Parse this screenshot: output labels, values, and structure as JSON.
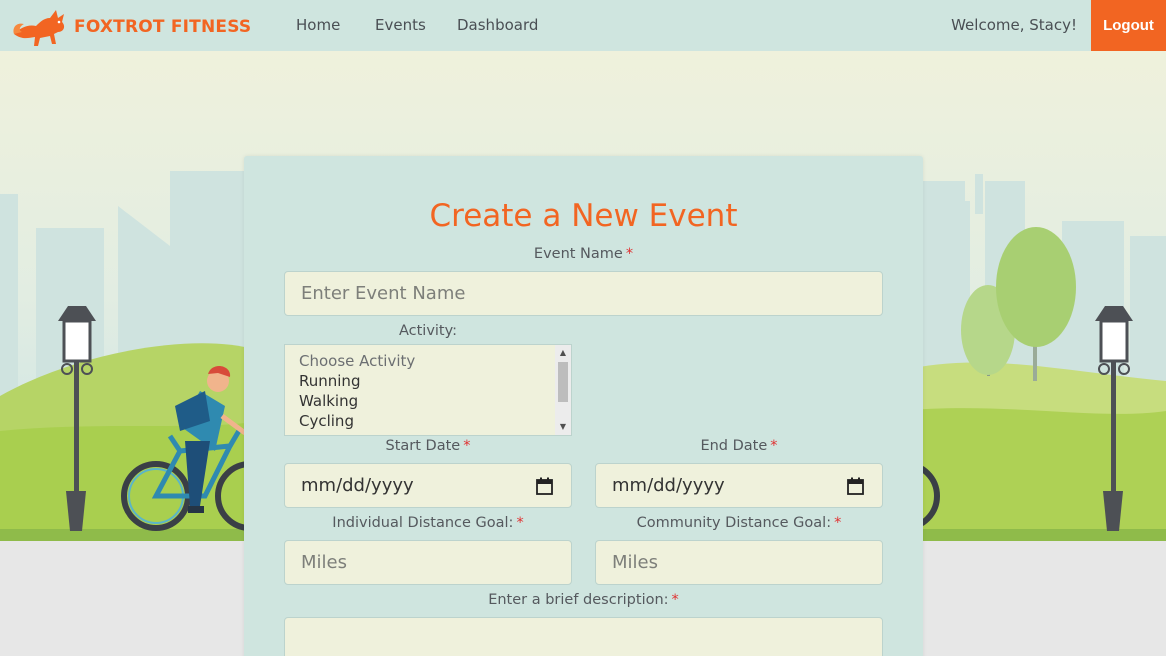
{
  "brand": {
    "name": "FOXTROT FITNESS",
    "accent": "#f26522"
  },
  "nav": {
    "items": [
      "Home",
      "Events",
      "Dashboard"
    ]
  },
  "user": {
    "welcome": "Welcome, Stacy!",
    "logout_label": "Logout"
  },
  "form": {
    "title": "Create a New Event",
    "event_name": {
      "label": "Event Name",
      "placeholder": "Enter Event Name",
      "required": "*"
    },
    "activity": {
      "label": "Activity:",
      "options": [
        "Choose Activity",
        "Running",
        "Walking",
        "Cycling"
      ]
    },
    "start_date": {
      "label": "Start Date",
      "placeholder": "mm/dd/yyyy",
      "required": "*"
    },
    "end_date": {
      "label": "End Date",
      "placeholder": "mm/dd/yyyy",
      "required": "*"
    },
    "individual_goal": {
      "label": "Individual Distance Goal:",
      "placeholder": "Miles",
      "required": "*"
    },
    "community_goal": {
      "label": "Community Distance Goal:",
      "placeholder": "Miles",
      "required": "*"
    },
    "description": {
      "label": "Enter a brief description:",
      "required": "*"
    }
  },
  "colors": {
    "header_bg": "#cfe5df",
    "card_bg": "#cfe5df",
    "input_bg": "#eff1dc",
    "hero_bg": "#eff1dc",
    "required": "#e03131"
  },
  "icons": [
    "fox-logo-icon",
    "calendar-icon",
    "scroll-up-icon",
    "scroll-down-icon"
  ]
}
